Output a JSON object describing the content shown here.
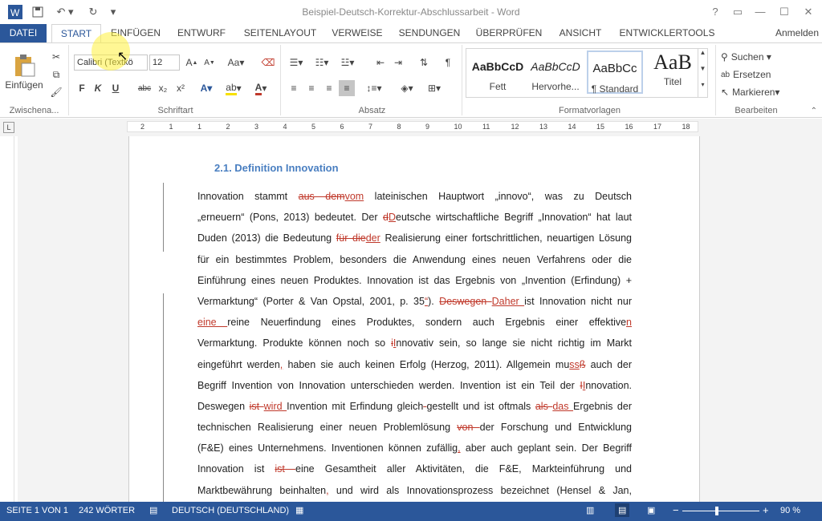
{
  "window": {
    "title": "Beispiel-Deutsch-Korrektur-Abschlussarbeit - Word",
    "signin": "Anmelden"
  },
  "tabs": [
    "DATEI",
    "START",
    "EINFÜGEN",
    "ENTWURF",
    "SEITENLAYOUT",
    "VERWEISE",
    "SENDUNGEN",
    "ÜBERPRÜFEN",
    "ANSICHT",
    "ENTWICKLERTOOLS"
  ],
  "ribbon": {
    "clipboard": {
      "paste": "Einfügen",
      "label": "Zwischena..."
    },
    "font": {
      "name": "Calibri (Textkö",
      "size": "12",
      "bold": "F",
      "italic": "K",
      "underline": "U",
      "strike": "abc",
      "sub": "x₂",
      "sup": "x²",
      "label": "Schriftart"
    },
    "paragraph": {
      "label": "Absatz"
    },
    "styles": {
      "items": [
        {
          "preview": "AaBbCcD",
          "name": "Fett"
        },
        {
          "preview": "AaBbCcD",
          "name": "Hervorhe..."
        },
        {
          "preview": "AaBbCc",
          "name": "¶ Standard"
        },
        {
          "preview": "AaB",
          "name": "Titel"
        }
      ],
      "label": "Formatvorlagen"
    },
    "editing": {
      "find": "Suchen",
      "replace": "Ersetzen",
      "select": "Markieren",
      "label": "Bearbeiten"
    }
  },
  "ruler": {
    "numbers": [
      "2",
      "1",
      "1",
      "2",
      "3",
      "4",
      "5",
      "6",
      "7",
      "8",
      "9",
      "10",
      "11",
      "12",
      "13",
      "14",
      "15",
      "16",
      "17",
      "18"
    ]
  },
  "document": {
    "heading": "2.1. Definition Innovation"
  },
  "status": {
    "page": "SEITE 1 VON 1",
    "words": "242 WÖRTER",
    "language": "DEUTSCH (DEUTSCHLAND)",
    "zoom": "90 %",
    "zoom_level": 0.9
  },
  "colors": {
    "accent": "#2b579a",
    "revision": "#c0392b",
    "heading": "#4a7fc1"
  }
}
